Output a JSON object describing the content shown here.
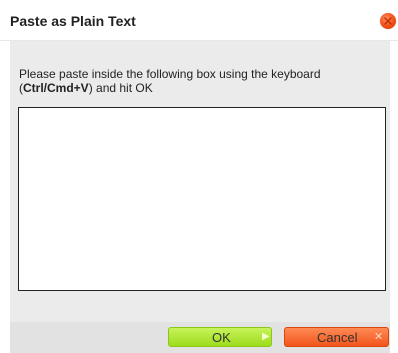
{
  "dialog": {
    "title": "Paste as Plain Text",
    "close_icon": "close-icon",
    "instructions_prefix": "Please paste inside the following box using the keyboard (",
    "shortcut": "Ctrl/Cmd+V",
    "instructions_suffix": ") and hit OK",
    "paste_box_value": "",
    "ok_label": "OK",
    "cancel_label": "Cancel",
    "ok_icon": "triangle-right-icon",
    "cancel_icon": "x-icon",
    "colors": {
      "close": "#f04a12",
      "ok": "#9ddc1c",
      "cancel": "#f2541c",
      "body_bg": "#ebebeb"
    }
  }
}
